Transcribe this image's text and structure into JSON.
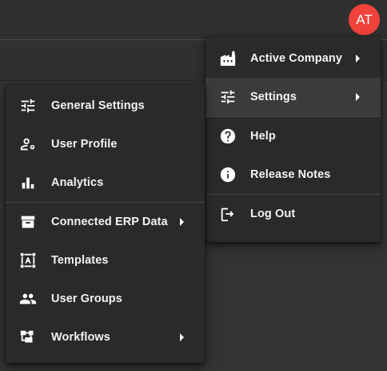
{
  "user": {
    "initials": "AT",
    "avatar_color": "#f0433a"
  },
  "main_menu": {
    "items": [
      {
        "label": "Active Company",
        "icon": "factory-icon",
        "submenu": true
      },
      {
        "label": "Settings",
        "icon": "tune-icon",
        "submenu": true,
        "active": true
      },
      {
        "label": "Help",
        "icon": "help-circle-icon"
      },
      {
        "label": "Release Notes",
        "icon": "info-icon"
      },
      {
        "label": "Log Out",
        "icon": "logout-icon"
      }
    ]
  },
  "settings_menu": {
    "items": [
      {
        "label": "General Settings",
        "icon": "tune-icon"
      },
      {
        "label": "User Profile",
        "icon": "user-gear-icon"
      },
      {
        "label": "Analytics",
        "icon": "bar-chart-icon"
      },
      {
        "label": "Connected ERP Data",
        "icon": "archive-icon",
        "submenu": true
      },
      {
        "label": "Templates",
        "icon": "template-icon"
      },
      {
        "label": "User Groups",
        "icon": "group-icon"
      },
      {
        "label": "Workflows",
        "icon": "workflow-icon",
        "submenu": true
      }
    ]
  },
  "colors": {
    "background": "#333333",
    "menu": "#2a2a2a",
    "active_item": "#3b3b3b"
  }
}
